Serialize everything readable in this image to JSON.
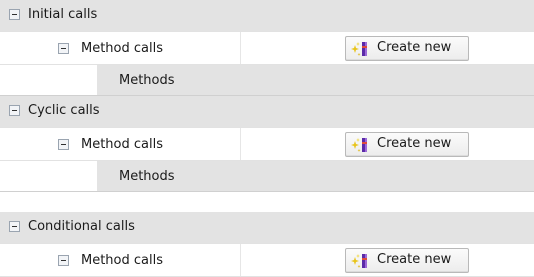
{
  "groups": [
    {
      "label": "Initial calls",
      "method_label": "Method calls",
      "button_label": "Create new",
      "methods_label": "Methods"
    },
    {
      "label": "Cyclic calls",
      "method_label": "Method calls",
      "button_label": "Create new",
      "methods_label": "Methods"
    },
    {
      "label": "Conditional calls",
      "method_label": "Method calls",
      "button_label": "Create new"
    }
  ],
  "icons": {
    "collapse": "minus-box-icon",
    "create_new": "wand-sparkle-icon"
  }
}
